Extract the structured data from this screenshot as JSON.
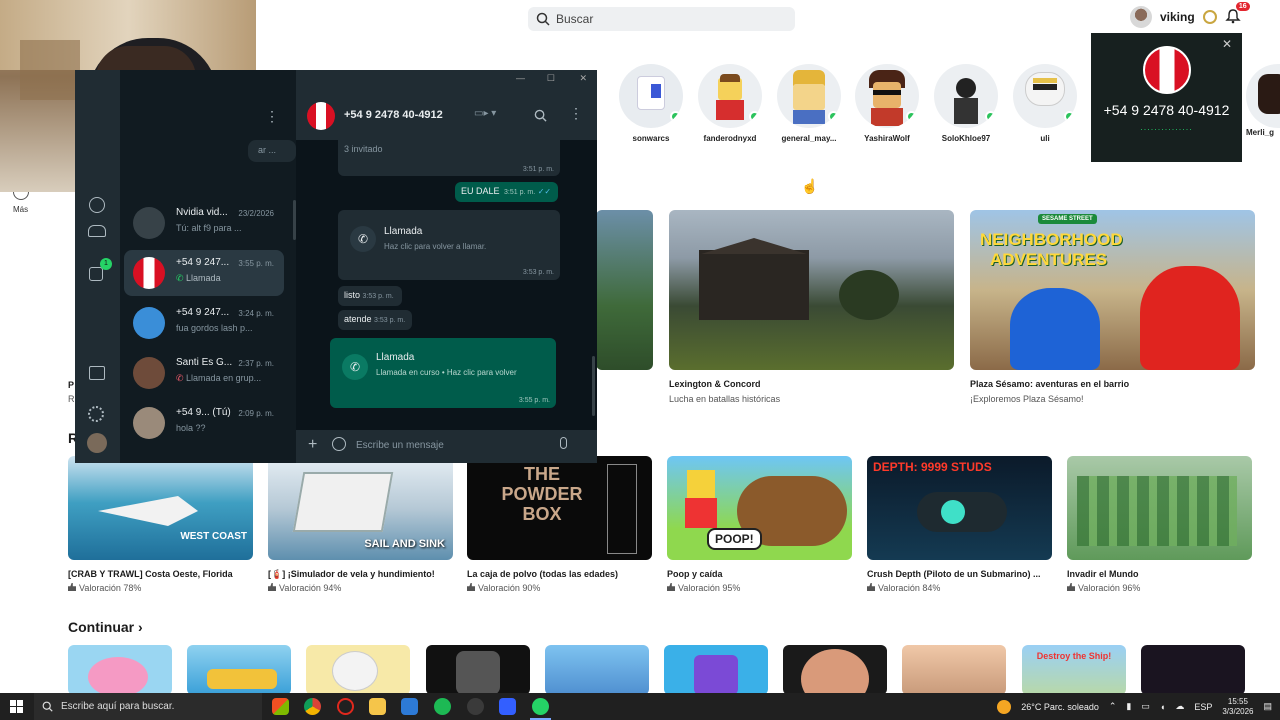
{
  "topbar": {
    "search_placeholder": "Buscar",
    "username": "viking",
    "notifications_count": "16"
  },
  "friends": [
    {
      "name": "sonwarcs",
      "online": true
    },
    {
      "name": "fanderodnyxd",
      "online": true
    },
    {
      "name": "general_may...",
      "online": true
    },
    {
      "name": "YashiraWolf",
      "online": true
    },
    {
      "name": "SoloKhloe97",
      "online": true
    },
    {
      "name": "uli",
      "online": true
    },
    {
      "name": "Merli_g",
      "online": false
    }
  ],
  "call_popup": {
    "number": "+54 9 2478 40-4912",
    "status_dots": "..............."
  },
  "left_nav": {
    "more_label": "Más"
  },
  "featured": [
    {
      "title": "Lexington & Concord",
      "subtitle": "Lucha en batallas históricas"
    },
    {
      "title": "Plaza Sésamo: aventuras en el barrio",
      "subtitle": "¡Exploremos Plaza Sésamo!",
      "thumb_text_1": "NEIGHBORHOOD",
      "thumb_text_2": "ADVENTURES",
      "thumb_badge": "SESAME STREET"
    }
  ],
  "recommended": [
    {
      "title": "[CRAB Y TRAWL] Costa Oeste, Florida",
      "rating": "Valoración 78%",
      "thumb_text": "WEST COAST"
    },
    {
      "title": "[🧯] ¡Simulador de vela y hundimiento!",
      "rating": "Valoración 94%",
      "thumb_text": "SAIL AND SINK"
    },
    {
      "title": "La caja de polvo (todas las edades)",
      "rating": "Valoración 90%",
      "thumb_text": "THE POWDER BOX"
    },
    {
      "title": "Poop y caída",
      "rating": "Valoración 95%",
      "thumb_text": "POOP!"
    },
    {
      "title": "Crush Depth (Piloto de un Submarino) ...",
      "rating": "Valoración 84%",
      "thumb_text": "DEPTH: 9999 STUDS"
    },
    {
      "title": "Invadir el Mundo",
      "rating": "Valoración 96%"
    }
  ],
  "continue_section": {
    "title": "Continuar",
    "tile_texts": [
      "",
      "",
      "",
      "",
      "",
      "",
      "",
      "",
      "Destroy the Ship!",
      ""
    ]
  },
  "whatsapp": {
    "header_number": "+54 9 2478 40-4912",
    "sidebar_badge": "1",
    "search_stub": "ar ...",
    "chats": [
      {
        "name": "Nvidia vid...",
        "time": "23/2/2026",
        "preview": "Tú: alt f9 para ..."
      },
      {
        "name": "+54 9 247...",
        "time": "3:55 p. m.",
        "preview": "Llamada"
      },
      {
        "name": "+54 9 247...",
        "time": "3:24 p. m.",
        "preview": "fua gordos lash p..."
      },
      {
        "name": "Santi Es G...",
        "time": "2:37 p. m.",
        "preview": "Llamada en grup..."
      },
      {
        "name": "+54 9... (Tú)",
        "time": "2:09 p. m.",
        "preview": "hola ??"
      }
    ],
    "messages": {
      "invited": "3 invitado",
      "invited_time": "3:51 p. m.",
      "eu_dale": "EU DALE",
      "eu_dale_time": "3:51 p. m.",
      "call1_title": "Llamada",
      "call1_sub": "Haz clic para volver a llamar.",
      "call1_time": "3:53 p. m.",
      "listo": "listo",
      "listo_time": "3:53 p. m.",
      "atende": "atende",
      "atende_time": "3:53 p. m.",
      "call2_title": "Llamada",
      "call2_sub": "Llamada en curso • Haz clic para volver",
      "call2_time": "3:55 p. m."
    },
    "input_placeholder": "Escribe un mensaje"
  },
  "taskbar": {
    "search_placeholder": "Escribe aquí para buscar.",
    "weather": "26°C  Parc. soleado",
    "lang": "ESP",
    "time": "15:55",
    "date": "3/3/2026"
  }
}
